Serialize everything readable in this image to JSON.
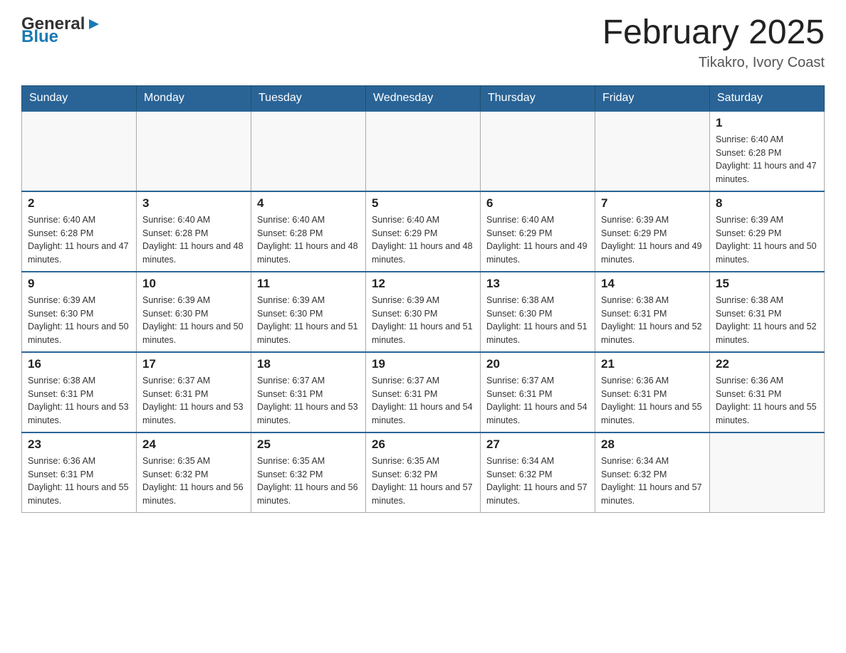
{
  "header": {
    "logo": {
      "general": "General",
      "blue": "Blue",
      "arrow": "▶"
    },
    "title": "February 2025",
    "location": "Tikakro, Ivory Coast"
  },
  "weekdays": [
    "Sunday",
    "Monday",
    "Tuesday",
    "Wednesday",
    "Thursday",
    "Friday",
    "Saturday"
  ],
  "weeks": [
    [
      {
        "day": "",
        "info": ""
      },
      {
        "day": "",
        "info": ""
      },
      {
        "day": "",
        "info": ""
      },
      {
        "day": "",
        "info": ""
      },
      {
        "day": "",
        "info": ""
      },
      {
        "day": "",
        "info": ""
      },
      {
        "day": "1",
        "info": "Sunrise: 6:40 AM\nSunset: 6:28 PM\nDaylight: 11 hours and 47 minutes."
      }
    ],
    [
      {
        "day": "2",
        "info": "Sunrise: 6:40 AM\nSunset: 6:28 PM\nDaylight: 11 hours and 47 minutes."
      },
      {
        "day": "3",
        "info": "Sunrise: 6:40 AM\nSunset: 6:28 PM\nDaylight: 11 hours and 48 minutes."
      },
      {
        "day": "4",
        "info": "Sunrise: 6:40 AM\nSunset: 6:28 PM\nDaylight: 11 hours and 48 minutes."
      },
      {
        "day": "5",
        "info": "Sunrise: 6:40 AM\nSunset: 6:29 PM\nDaylight: 11 hours and 48 minutes."
      },
      {
        "day": "6",
        "info": "Sunrise: 6:40 AM\nSunset: 6:29 PM\nDaylight: 11 hours and 49 minutes."
      },
      {
        "day": "7",
        "info": "Sunrise: 6:39 AM\nSunset: 6:29 PM\nDaylight: 11 hours and 49 minutes."
      },
      {
        "day": "8",
        "info": "Sunrise: 6:39 AM\nSunset: 6:29 PM\nDaylight: 11 hours and 50 minutes."
      }
    ],
    [
      {
        "day": "9",
        "info": "Sunrise: 6:39 AM\nSunset: 6:30 PM\nDaylight: 11 hours and 50 minutes."
      },
      {
        "day": "10",
        "info": "Sunrise: 6:39 AM\nSunset: 6:30 PM\nDaylight: 11 hours and 50 minutes."
      },
      {
        "day": "11",
        "info": "Sunrise: 6:39 AM\nSunset: 6:30 PM\nDaylight: 11 hours and 51 minutes."
      },
      {
        "day": "12",
        "info": "Sunrise: 6:39 AM\nSunset: 6:30 PM\nDaylight: 11 hours and 51 minutes."
      },
      {
        "day": "13",
        "info": "Sunrise: 6:38 AM\nSunset: 6:30 PM\nDaylight: 11 hours and 51 minutes."
      },
      {
        "day": "14",
        "info": "Sunrise: 6:38 AM\nSunset: 6:31 PM\nDaylight: 11 hours and 52 minutes."
      },
      {
        "day": "15",
        "info": "Sunrise: 6:38 AM\nSunset: 6:31 PM\nDaylight: 11 hours and 52 minutes."
      }
    ],
    [
      {
        "day": "16",
        "info": "Sunrise: 6:38 AM\nSunset: 6:31 PM\nDaylight: 11 hours and 53 minutes."
      },
      {
        "day": "17",
        "info": "Sunrise: 6:37 AM\nSunset: 6:31 PM\nDaylight: 11 hours and 53 minutes."
      },
      {
        "day": "18",
        "info": "Sunrise: 6:37 AM\nSunset: 6:31 PM\nDaylight: 11 hours and 53 minutes."
      },
      {
        "day": "19",
        "info": "Sunrise: 6:37 AM\nSunset: 6:31 PM\nDaylight: 11 hours and 54 minutes."
      },
      {
        "day": "20",
        "info": "Sunrise: 6:37 AM\nSunset: 6:31 PM\nDaylight: 11 hours and 54 minutes."
      },
      {
        "day": "21",
        "info": "Sunrise: 6:36 AM\nSunset: 6:31 PM\nDaylight: 11 hours and 55 minutes."
      },
      {
        "day": "22",
        "info": "Sunrise: 6:36 AM\nSunset: 6:31 PM\nDaylight: 11 hours and 55 minutes."
      }
    ],
    [
      {
        "day": "23",
        "info": "Sunrise: 6:36 AM\nSunset: 6:31 PM\nDaylight: 11 hours and 55 minutes."
      },
      {
        "day": "24",
        "info": "Sunrise: 6:35 AM\nSunset: 6:32 PM\nDaylight: 11 hours and 56 minutes."
      },
      {
        "day": "25",
        "info": "Sunrise: 6:35 AM\nSunset: 6:32 PM\nDaylight: 11 hours and 56 minutes."
      },
      {
        "day": "26",
        "info": "Sunrise: 6:35 AM\nSunset: 6:32 PM\nDaylight: 11 hours and 57 minutes."
      },
      {
        "day": "27",
        "info": "Sunrise: 6:34 AM\nSunset: 6:32 PM\nDaylight: 11 hours and 57 minutes."
      },
      {
        "day": "28",
        "info": "Sunrise: 6:34 AM\nSunset: 6:32 PM\nDaylight: 11 hours and 57 minutes."
      },
      {
        "day": "",
        "info": ""
      }
    ]
  ]
}
